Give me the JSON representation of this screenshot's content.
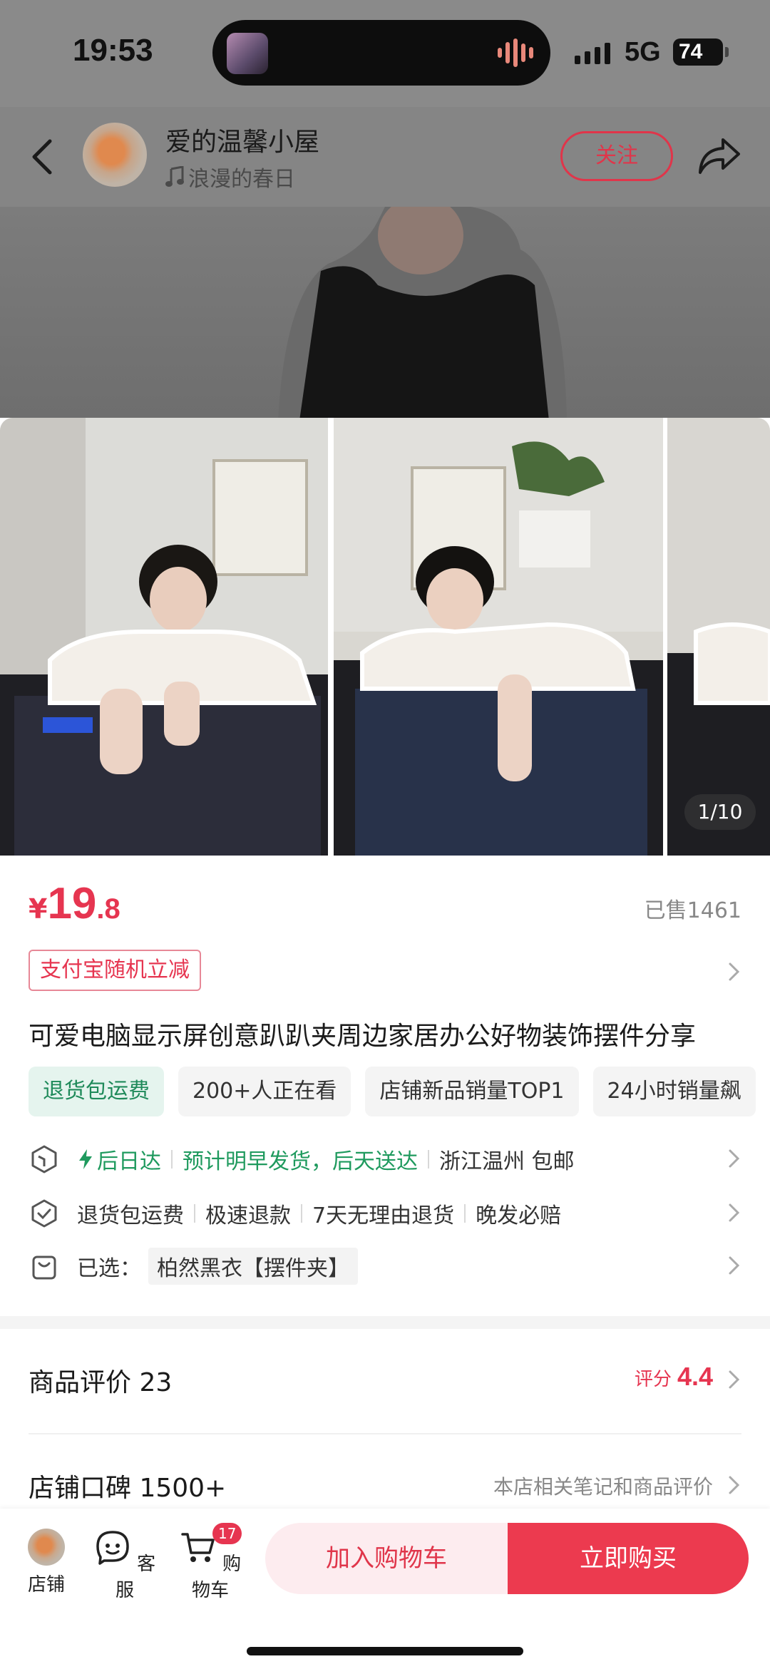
{
  "status_bar": {
    "time": "19:53",
    "network": "5G",
    "battery": "74"
  },
  "header": {
    "shop_name": "爱的温馨小屋",
    "music": "浪漫的春日",
    "follow_label": "关注"
  },
  "gallery": {
    "counter": "1/10"
  },
  "product": {
    "currency": "¥",
    "price_int": "19",
    "price_dec": ".8",
    "sold": "已售1461",
    "promo": "支付宝随机立减",
    "title": "可爱电脑显示屏创意趴趴夹周边家居办公好物装饰摆件分享",
    "chips": [
      "退货包运费",
      "200+人正在看",
      "店铺新品销量TOP1",
      "24小时销量飙"
    ]
  },
  "shipping": {
    "speed": "后日达",
    "estimate": "预计明早发货，后天送达",
    "origin": "浙江温州 包邮"
  },
  "guarantees": [
    "退货包运费",
    "极速退款",
    "7天无理由退货",
    "晚发必赔"
  ],
  "selection": {
    "label": "已选：",
    "value": "柏然黑衣【摆件夹】"
  },
  "reviews": {
    "title": "商品评价 23",
    "score_label": "评分",
    "score": "4.4"
  },
  "reputation": {
    "title": "店铺口碑 1500+",
    "subtitle": "本店相关笔记和商品评价"
  },
  "bottom_bar": {
    "shop": "店铺",
    "service": "客服",
    "cart": "购物车",
    "cart_count": "17",
    "add_to_cart": "加入购物车",
    "buy_now": "立即购买"
  },
  "colors": {
    "accent": "#e63550",
    "green": "#1f9a5e",
    "buy": "#ec3a4f"
  }
}
